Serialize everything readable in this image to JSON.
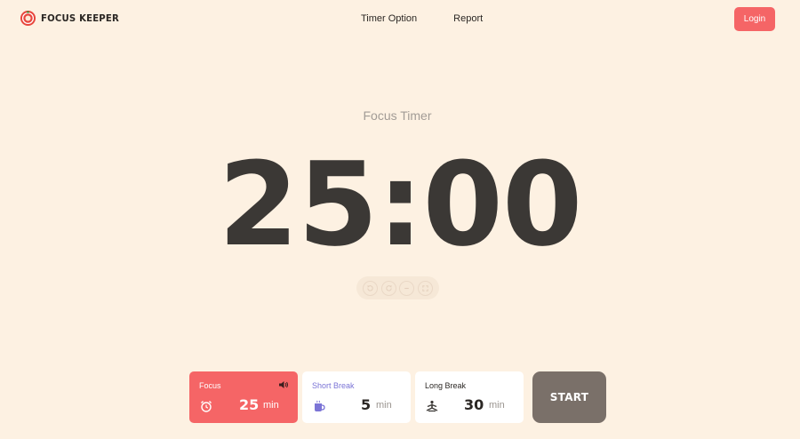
{
  "header": {
    "brand_name": "FOCUS KEEPER",
    "brand_icon": "tomato-logo-icon",
    "nav": [
      "Timer Option",
      "Report"
    ],
    "login_label": "Login"
  },
  "timer": {
    "title": "Focus Timer",
    "display": "25:00",
    "controls": [
      "reset-icon",
      "skip-icon",
      "minus-icon",
      "fullscreen-icon"
    ]
  },
  "modes": [
    {
      "label": "Focus",
      "value": "25",
      "unit": "min",
      "icon": "alarm-clock-icon",
      "active": true,
      "sound_icon": "speaker-icon"
    },
    {
      "label": "Short Break",
      "value": "5",
      "unit": "min",
      "icon": "coffee-cup-icon",
      "active": false
    },
    {
      "label": "Long Break",
      "value": "30",
      "unit": "min",
      "icon": "meditation-icon",
      "active": false
    }
  ],
  "start_label": "START",
  "colors": {
    "background": "#fdf1e2",
    "accent": "#f56566",
    "start_button": "#7a7069",
    "short_break_label": "#7b74d6"
  }
}
